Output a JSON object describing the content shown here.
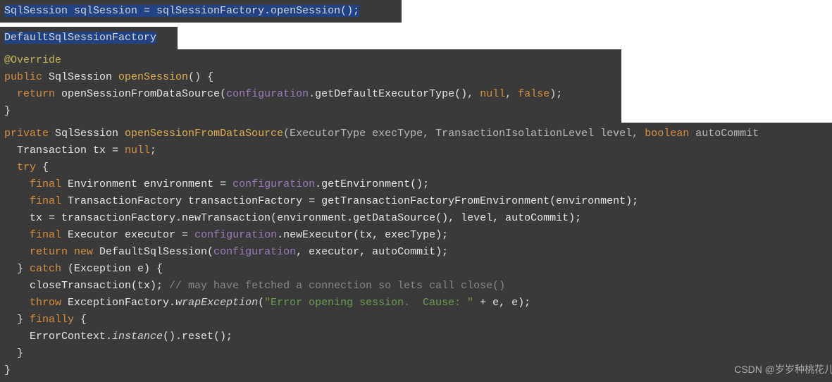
{
  "block1": {
    "t1": "SqlSession sqlSession = sqlSessionFactory.openSession();"
  },
  "block2": {
    "t1": "DefaultSqlSessionFactory"
  },
  "block3": {
    "l1_anno": "@Override",
    "l2_kw": "public",
    "l2_type": " SqlSession ",
    "l2_fn": "openSession",
    "l2_rest": "() {",
    "l3_ret": "  return",
    "l3_fn": " openSessionFromDataSource",
    "l3_p1": "(",
    "l3_conf": "configuration",
    "l3_dot": ".",
    "l3_call": "getDefaultExecutorType()",
    "l3_c1": ", ",
    "l3_null": "null",
    "l3_c2": ", ",
    "l3_false": "false",
    "l3_end": ");",
    "l4": "}"
  },
  "block4": {
    "l1_kw": "private",
    "l1_type": " SqlSession ",
    "l1_fn": "openSessionFromDataSource",
    "l1_sig1": "(ExecutorType execType, TransactionIsolationLevel level, ",
    "l1_bool": "boolean",
    "l1_sig2": " autoCommit",
    "l2_a": "  Transaction tx = ",
    "l2_null": "null",
    "l2_b": ";",
    "l3_try": "  try",
    "l3_b": " {",
    "l4_a": "    ",
    "l4_final": "final",
    "l4_b": " Environment environment = ",
    "l4_conf": "configuration",
    "l4_c": ".getEnvironment();",
    "l5_a": "    ",
    "l5_final": "final",
    "l5_b": " TransactionFactory transactionFactory = getTransactionFactoryFromEnvironment(environment);",
    "l6": "    tx = transactionFactory.newTransaction(environment.getDataSource(), level, autoCommit);",
    "l7_a": "    ",
    "l7_final": "final",
    "l7_b": " Executor executor = ",
    "l7_conf": "configuration",
    "l7_c": ".newExecutor(tx, execType);",
    "l8_a": "    ",
    "l8_ret": "return new",
    "l8_b": " DefaultSqlSession(",
    "l8_conf": "configuration",
    "l8_c": ", executor, autoCommit);",
    "l9_a": "  } ",
    "l9_catch": "catch",
    "l9_b": " (Exception e) {",
    "l10_a": "    closeTransaction(tx); ",
    "l10_comment": "// may have fetched a connection so lets call close()",
    "l11_a": "    ",
    "l11_throw": "throw",
    "l11_b": " ExceptionFactory.",
    "l11_wrap": "wrapException",
    "l11_c": "(",
    "l11_str": "\"Error opening session.  Cause: \"",
    "l11_d": " + e, e);",
    "l12_a": "  } ",
    "l12_fin": "finally",
    "l12_b": " {",
    "l13_a": "    ErrorContext.",
    "l13_inst": "instance",
    "l13_b": "().reset();",
    "l14": "  }",
    "l15": "}"
  },
  "watermark": "CSDN @岁岁种桃花儿"
}
